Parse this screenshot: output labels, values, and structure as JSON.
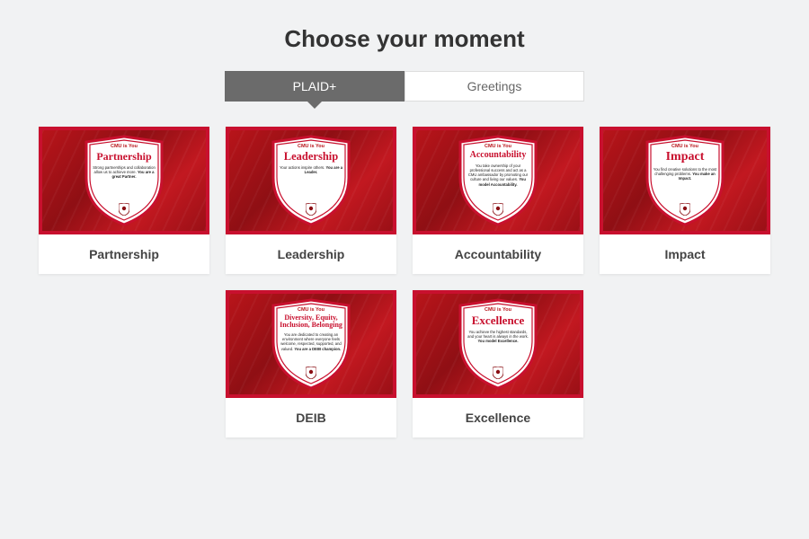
{
  "header": {
    "title": "Choose your moment"
  },
  "tabs": {
    "active": "PLAID+",
    "inactive": "Greetings"
  },
  "brand": "CMU is You",
  "cards": [
    {
      "label": "Partnership",
      "shield_title": "Partnership",
      "title_size": "12px",
      "desc": "Strong partnerships and collaboration allow us to achieve more.",
      "bold": "You are a great Partner."
    },
    {
      "label": "Leadership",
      "shield_title": "Leadership",
      "title_size": "12.5px",
      "desc": "Your actions inspire others.",
      "bold": "You are a Leader."
    },
    {
      "label": "Accountability",
      "shield_title": "Accountability",
      "title_size": "10px",
      "desc": "You take ownership of your professional success and act as a CMU ambassador by promoting our culture and living our values.",
      "bold": "You model Accountability."
    },
    {
      "label": "Impact",
      "shield_title": "Impact",
      "title_size": "14px",
      "desc": "You find creative solutions to the most challenging problems.",
      "bold": "You make an Impact."
    },
    {
      "label": "DEIB",
      "shield_title": "Diversity, Equity, Inclusion, Belonging",
      "title_size": "8px",
      "desc": "You are dedicated to creating an environment where everyone feels welcome, respected, supported, and valued.",
      "bold": "You are a DEIB champion."
    },
    {
      "label": "Excellence",
      "shield_title": "Excellence",
      "title_size": "13px",
      "desc": "You achieve the highest standards, and your heart is always in the work.",
      "bold": "You model Excellence."
    }
  ]
}
